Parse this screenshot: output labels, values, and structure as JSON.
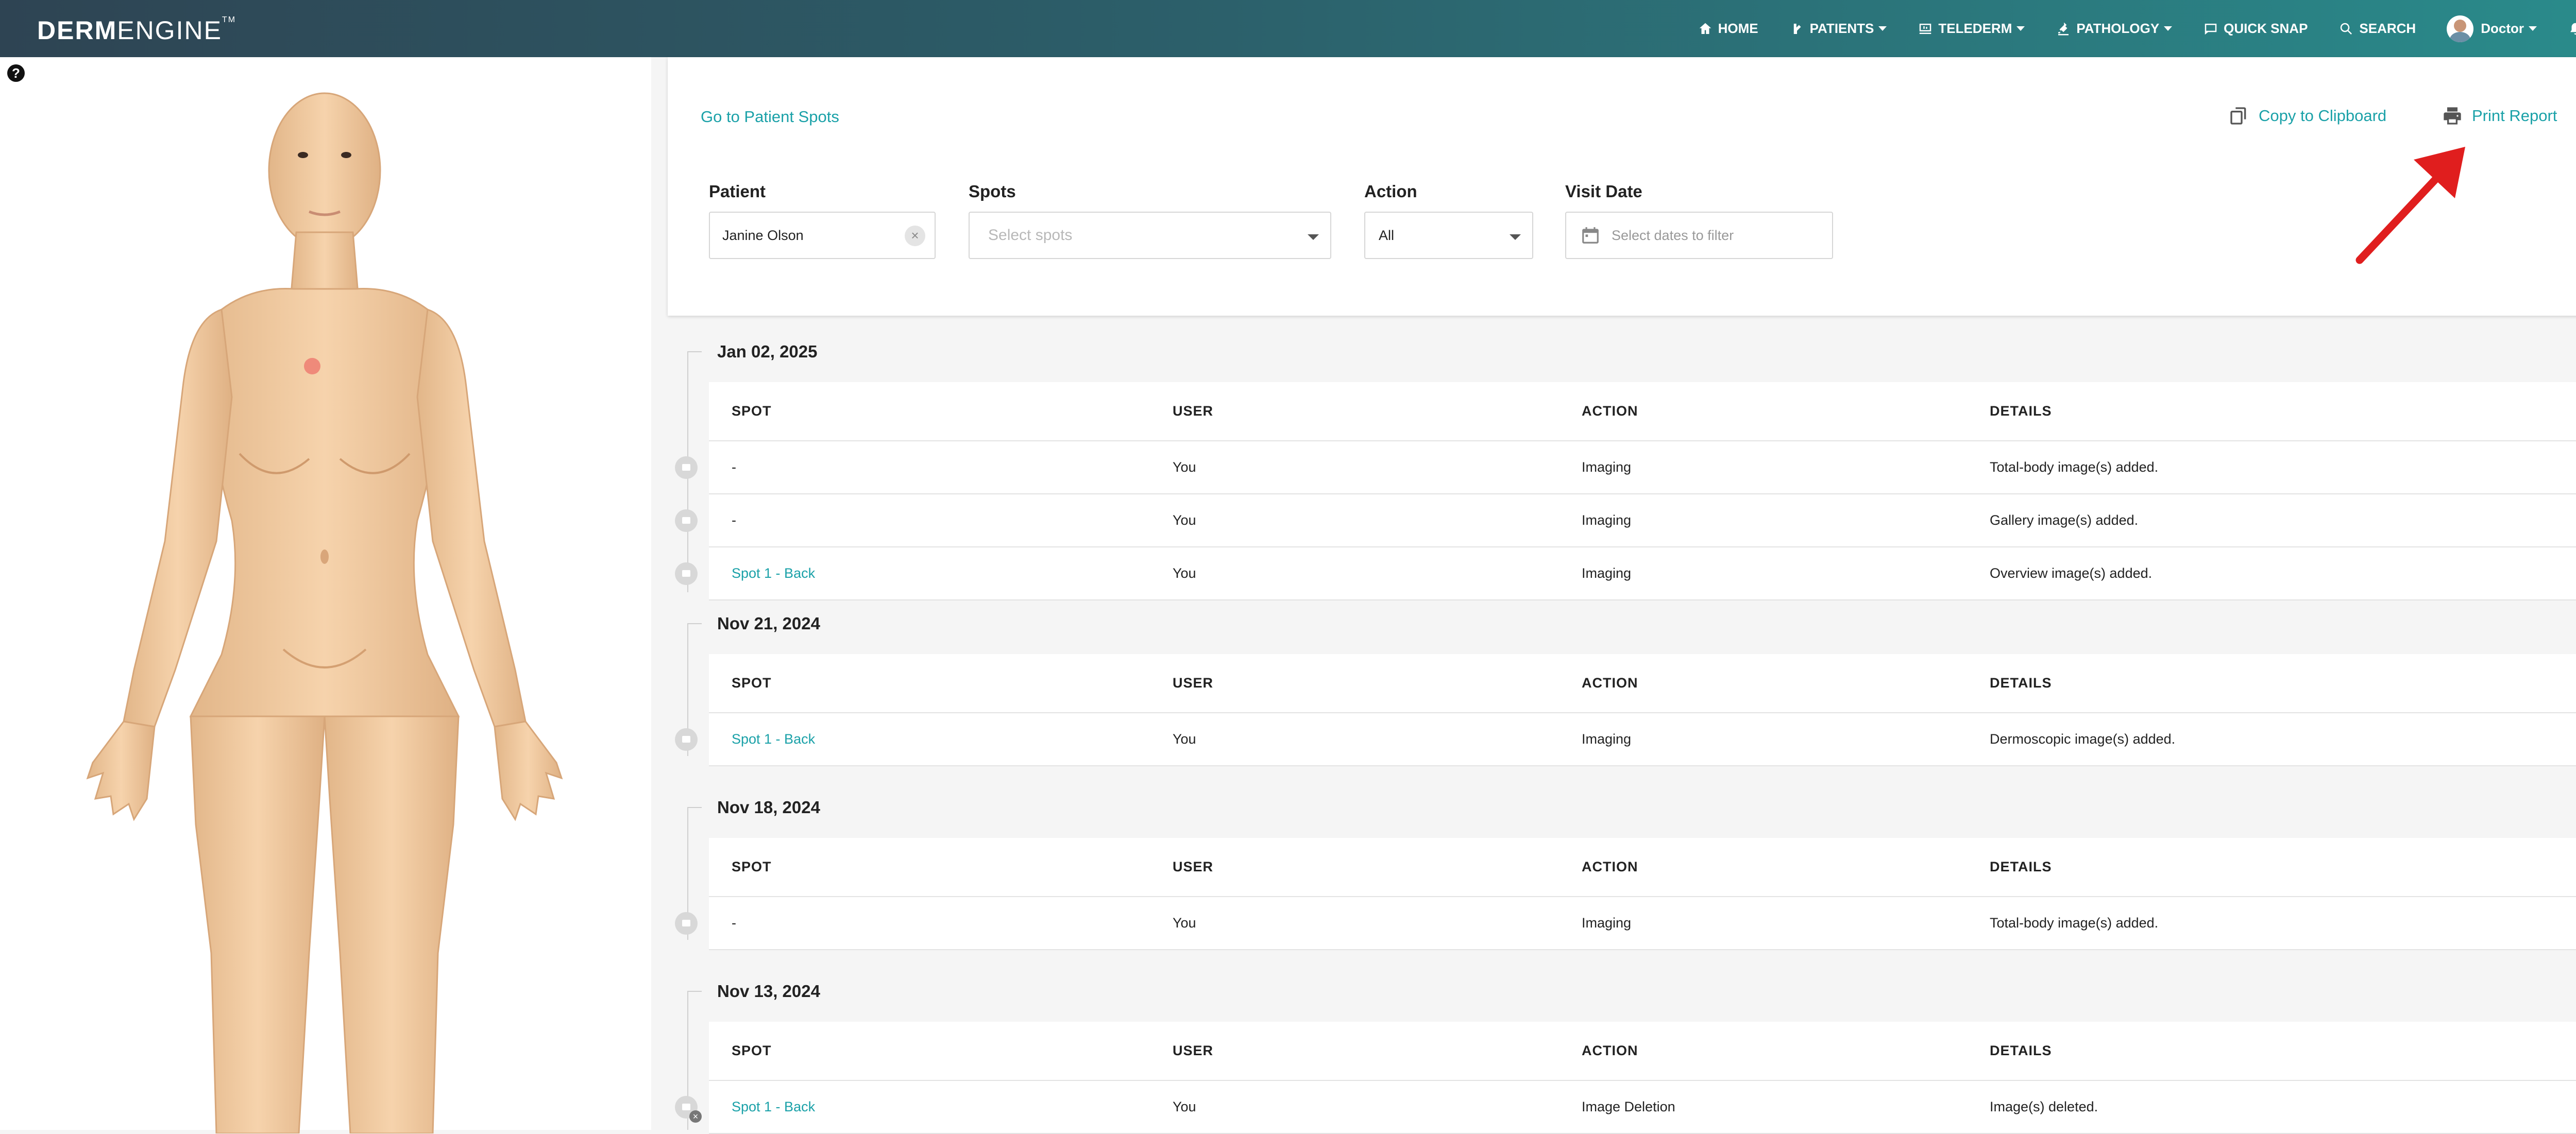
{
  "nav": {
    "logo_bold": "DERM",
    "logo_light": "ENGINE",
    "logo_tm": "TM",
    "items": [
      {
        "label": "HOME",
        "icon": "home-icon",
        "dropdown": false
      },
      {
        "label": "PATIENTS",
        "icon": "patients-icon",
        "dropdown": true
      },
      {
        "label": "TELEDERM",
        "icon": "telederm-icon",
        "dropdown": true
      },
      {
        "label": "PATHOLOGY",
        "icon": "pathology-icon",
        "dropdown": true
      },
      {
        "label": "QUICK SNAP",
        "icon": "quick-snap-icon",
        "dropdown": false
      },
      {
        "label": "SEARCH",
        "icon": "search-icon",
        "dropdown": false
      }
    ],
    "user_label": "Doctor"
  },
  "left": {
    "help": "?"
  },
  "filters": {
    "go_link": "Go to Patient Spots",
    "copy_label": "Copy to Clipboard",
    "print_label": "Print Report",
    "patient_label": "Patient",
    "patient_value": "Janine Olson",
    "spots_label": "Spots",
    "spots_placeholder": "Select spots",
    "action_label": "Action",
    "action_value": "All",
    "date_label": "Visit Date",
    "date_placeholder": "Select dates to filter"
  },
  "table_headers": {
    "spot": "SPOT",
    "user": "USER",
    "action": "ACTION",
    "details": "DETAILS"
  },
  "groups": [
    {
      "date": "Jan 02, 2025",
      "rows": [
        {
          "spot": "-",
          "user": "You",
          "action": "Imaging",
          "details": "Total-body image(s) added."
        },
        {
          "spot": "-",
          "user": "You",
          "action": "Imaging",
          "details": "Gallery image(s) added."
        },
        {
          "spot": "Spot 1 - Back",
          "user": "You",
          "action": "Imaging",
          "details": "Overview image(s) added."
        }
      ]
    },
    {
      "date": "Nov 21, 2024",
      "rows": [
        {
          "spot": "Spot 1 - Back",
          "user": "You",
          "action": "Imaging",
          "details": "Dermoscopic image(s) added."
        }
      ]
    },
    {
      "date": "Nov 18, 2024",
      "rows": [
        {
          "spot": "-",
          "user": "You",
          "action": "Imaging",
          "details": "Total-body image(s) added."
        }
      ]
    },
    {
      "date": "Nov 13, 2024",
      "rows": [
        {
          "spot": "Spot 1 - Back",
          "user": "You",
          "action": "Image Deletion",
          "details": "Image(s) deleted."
        }
      ]
    }
  ],
  "colors": {
    "accent": "#1aa1a8",
    "nav_start": "#2e4453",
    "nav_end": "#2a8c8c",
    "annotation_arrow": "#e01e1e",
    "spot_marker": "#ef8a7a"
  }
}
